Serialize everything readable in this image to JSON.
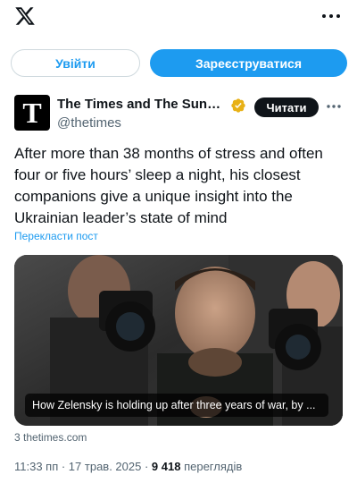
{
  "header": {
    "logo_icon": "x-logo-icon",
    "menu_icon": "more-vertical-icon"
  },
  "auth": {
    "login_label": "Увійти",
    "signup_label": "Зареєструватися"
  },
  "post": {
    "author_name": "The Times and The Sunda...",
    "author_handle": "@thetimes",
    "avatar_letter": "T",
    "verified_icon": "gold-verified-badge-icon",
    "follow_label": "Читати",
    "more_icon": "more-horizontal-icon",
    "text": "After more than 38 months of stress and often four or five hours’ sleep a night, his closest companions give a unique insight into the Ukrainian leader’s state of mind",
    "translate_label": "Перекласти пост",
    "media": {
      "caption": "How Zelensky is holding up after three years of war, by ...",
      "image_icon": "photo-zelensky-with-photographers"
    },
    "link_source": "3 thetimes.com",
    "timestamp": "11:33 пп · 17 трав. 2025 · ",
    "views_count": "9 418",
    "views_label": " переглядів"
  },
  "colors": {
    "accent": "#1d9bf0",
    "text": "#0f1419",
    "muted": "#536471",
    "verified": "#e8b116"
  }
}
